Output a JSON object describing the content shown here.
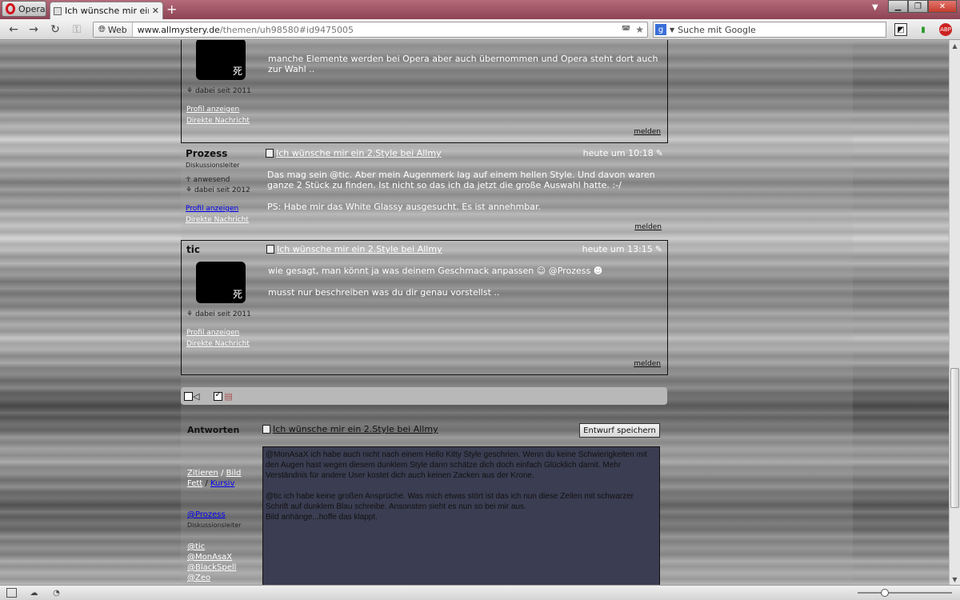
{
  "browser": {
    "menu_label": "Opera",
    "tab_title": "Ich wünsche mir ein 2....",
    "web_badge": "Web",
    "url_domain": "www.allmystery.de",
    "url_path": "/themen/uh98580#id9475005",
    "search_placeholder": "Suche mit Google"
  },
  "posts": [
    {
      "author": "",
      "joined": "dabei seit 2011",
      "profile_link": "Profil anzeigen",
      "message_link": "Direkte Nachricht",
      "avatar_glyph": "死",
      "body": [
        "manche Elemente werden bei Opera aber auch übernommen und Opera steht dort auch zur Wahl .."
      ],
      "report": "melden"
    },
    {
      "author": "Prozess",
      "role": "Diskussionsleiter",
      "status": "anwesend",
      "joined": "dabei seit 2012",
      "profile_link": "Profil anzeigen",
      "message_link": "Direkte Nachricht",
      "subject": "Ich wünsche mir ein 2.Style bei Allmy",
      "time": "heute um 10:18",
      "body": [
        "Das mag sein @tic. Aber mein Augenmerk lag auf einem hellen Style. Und davon waren ganze 2 Stück zu finden. Ist nicht so das ich da jetzt die große Auswahl hatte. :-/",
        "PS: Habe mir das White Glassy ausgesucht. Es ist annehmbar."
      ],
      "report": "melden"
    },
    {
      "author": "tic",
      "joined": "dabei seit 2011",
      "profile_link": "Profil anzeigen",
      "message_link": "Direkte Nachricht",
      "avatar_glyph": "死",
      "subject": "Ich wünsche mir ein 2.Style bei Allmy",
      "time": "heute um 13:15",
      "body": [
        "wie gesagt, man könnt ja was deinem Geschmack anpassen ☺ @Prozess ☻",
        "musst nur beschreiben was du dir genau vorstellst .."
      ],
      "report": "melden"
    }
  ],
  "reply": {
    "label": "Antworten",
    "subject": "Ich wünsche mir ein 2.Style bei Allmy",
    "draft_button": "Entwurf speichern",
    "tools": {
      "quote": "Zitieren",
      "image": "Bild",
      "bold": "Fett",
      "italic": "Kursiv",
      "sep": "/"
    },
    "mention_main": "@Prozess",
    "mention_main_role": "Diskussionsleiter",
    "mentions": [
      "@tic",
      "@MonAsaX",
      "@BlackSpell",
      "@Zeo"
    ],
    "text": [
      "@MonAsaX ich habe auch nicht nach einem Hello Kitty Style geschrien. Wenn du keine Schwierigkeiten mit den Augen hast wegen diesem dunklem Style dann schätze dich doch einfach Glücklich damit. Mehr Verständnis für andere User kostet dich auch keinen Zacken aus der Krone.",
      "@tic ich habe keine großen Ansprüche. Was mich etwas stört ist das ich nun diese Zeilen mit schwarzer Schrift auf dunklem Blau schreibe. Ansonsten sieht es nun so bei mir aus.\nBild anhänge...hoffe das klappt."
    ]
  },
  "zoom_fraction": 0.27
}
